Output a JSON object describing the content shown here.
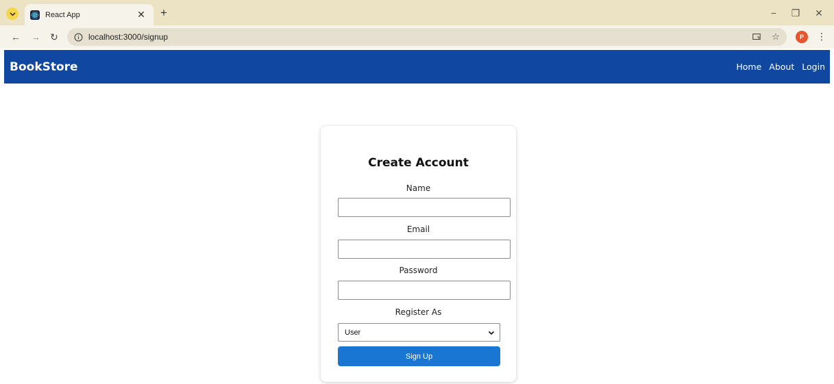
{
  "browser": {
    "tab_title": "React App",
    "url": "localhost:3000/signup",
    "profile_initial": "P",
    "icons": {
      "tab_menu": "chevron-down-icon",
      "favicon": "react-logo-icon",
      "close": "close-icon",
      "new_tab": "plus-icon",
      "back": "back-arrow-icon",
      "forward": "forward-arrow-icon",
      "reload": "reload-icon",
      "site_info": "info-icon",
      "cast": "cast-icon",
      "bookmark": "star-icon",
      "menu": "kebab-menu-icon"
    }
  },
  "navbar": {
    "brand": "BookStore",
    "links": [
      "Home",
      "About",
      "Login"
    ],
    "background": "#0f47a1"
  },
  "form": {
    "title": "Create Account",
    "name_label": "Name",
    "name_value": "",
    "email_label": "Email",
    "email_value": "",
    "password_label": "Password",
    "password_value": "",
    "role_label": "Register As",
    "role_selected": "User",
    "submit_label": "Sign Up",
    "button_color": "#1976d2"
  }
}
